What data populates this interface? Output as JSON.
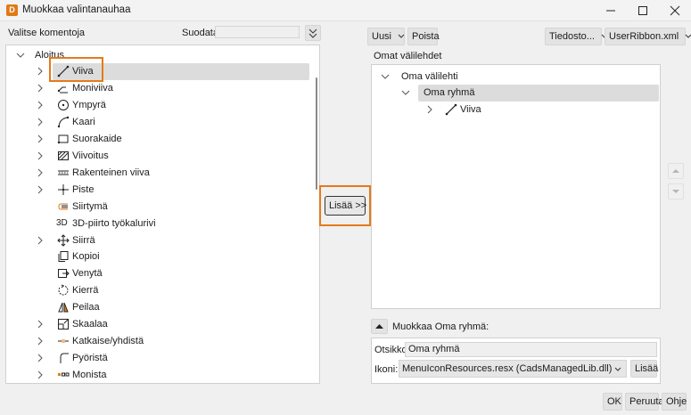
{
  "window": {
    "title": "Muokkaa valintanauhaa",
    "app_icon_letter": "D",
    "controls": [
      "minimize-icon",
      "maximize-icon",
      "close-icon"
    ]
  },
  "left": {
    "header": "Valitse komentoja",
    "filter_label": "Suodata:",
    "filter_value": "",
    "root": "Aloitus",
    "items": [
      {
        "label": "Viiva",
        "icon": "line-icon",
        "expandable": true,
        "selected": true
      },
      {
        "label": "Moniviiva",
        "icon": "polyline-icon",
        "expandable": true
      },
      {
        "label": "Ympyrä",
        "icon": "circle-icon",
        "expandable": true
      },
      {
        "label": "Kaari",
        "icon": "arc-icon",
        "expandable": true
      },
      {
        "label": "Suorakaide",
        "icon": "rectangle-icon",
        "expandable": true
      },
      {
        "label": "Viivoitus",
        "icon": "hatch-icon",
        "expandable": true
      },
      {
        "label": "Rakenteinen viiva",
        "icon": "structured-line-icon",
        "expandable": true
      },
      {
        "label": "Piste",
        "icon": "point-icon",
        "expandable": true
      },
      {
        "label": "Siirtymä",
        "icon": "offset-icon",
        "expandable": false
      },
      {
        "label": "3D-piirto työkalurivi",
        "icon": "3d-icon",
        "icon_text": "3D",
        "expandable": false
      },
      {
        "label": "Siirrä",
        "icon": "move-icon",
        "expandable": true
      },
      {
        "label": "Kopioi",
        "icon": "copy-icon",
        "expandable": false
      },
      {
        "label": "Venytä",
        "icon": "stretch-icon",
        "expandable": false
      },
      {
        "label": "Kierrä",
        "icon": "rotate-icon",
        "expandable": false
      },
      {
        "label": "Peilaa",
        "icon": "mirror-icon",
        "expandable": false
      },
      {
        "label": "Skaalaa",
        "icon": "scale-icon",
        "expandable": true
      },
      {
        "label": "Katkaise/yhdistä",
        "icon": "trim-icon",
        "expandable": true
      },
      {
        "label": "Pyöristä",
        "icon": "fillet-icon",
        "expandable": true
      },
      {
        "label": "Monista",
        "icon": "array-icon",
        "expandable": true
      }
    ]
  },
  "middle": {
    "add_button": "Lisää >>"
  },
  "right": {
    "new_button": "Uusi",
    "delete_button": "Poista",
    "file_button": "Tiedosto...",
    "ribbon_file": "UserRibbon.xml",
    "header": "Omat välilehdet",
    "tree": {
      "tab": "Oma välilehti",
      "group": "Oma ryhmä",
      "command": "Viiva"
    },
    "edit_header": "Muokkaa Oma ryhmä:",
    "title_label": "Otsikko:",
    "title_value": "Oma ryhmä",
    "icon_label": "Ikoni:",
    "icon_value": "MenuIconResources.resx (CadsManagedLib.dll)",
    "icon_add_button": "Lisää"
  },
  "footer": {
    "ok": "OK",
    "cancel": "Peruuta",
    "help": "Ohje"
  },
  "colors": {
    "accent_orange": "#e47a1a",
    "selection": "#dcdcdc"
  }
}
